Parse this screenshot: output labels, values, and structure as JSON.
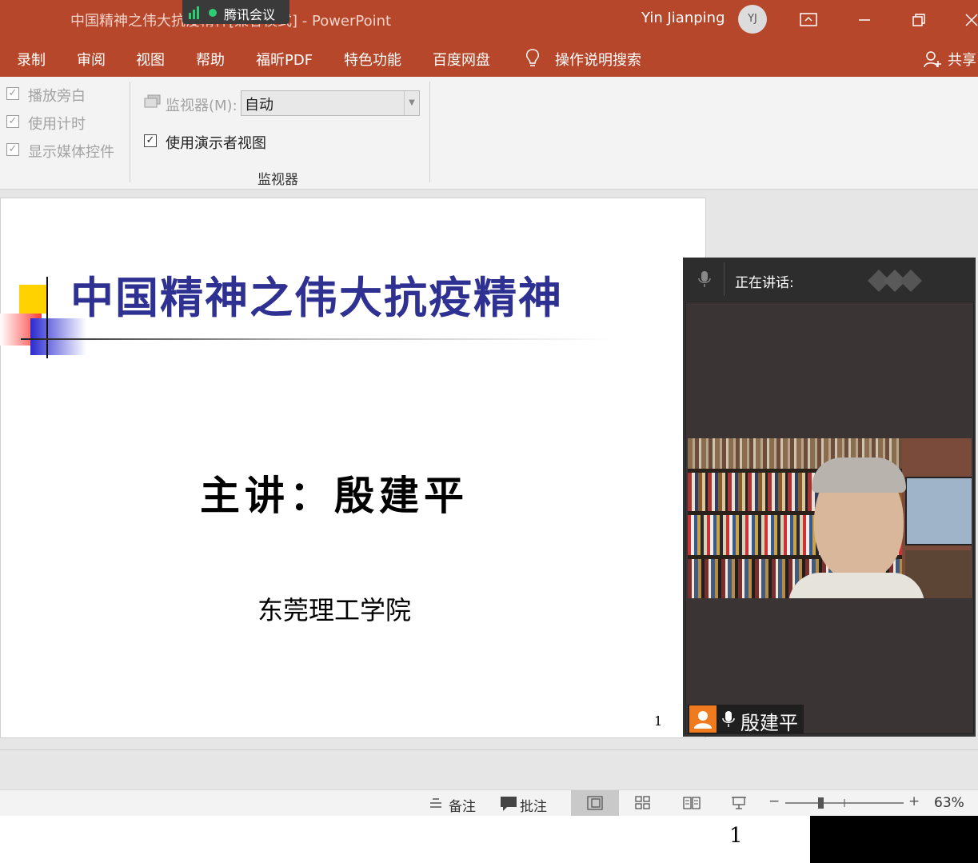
{
  "titlebar": {
    "doc_title": "中国精神之伟大抗疫精神[兼容模式]  -  PowerPoint",
    "meeting_app": "腾讯会议",
    "user_name": "Yin Jianping",
    "avatar_initials": "YJ"
  },
  "menu": {
    "items": [
      "录制",
      "审阅",
      "视图",
      "帮助",
      "福昕PDF",
      "特色功能",
      "百度网盘"
    ],
    "search_label": "操作说明搜索",
    "share_label": "共享"
  },
  "ribbon": {
    "checkboxes": [
      {
        "label": "播放旁白",
        "checked": true,
        "enabled": false
      },
      {
        "label": "使用计时",
        "checked": true,
        "enabled": false
      },
      {
        "label": "显示媒体控件",
        "checked": true,
        "enabled": false
      }
    ],
    "monitor_label": "监视器(M):",
    "monitor_value": "自动",
    "presenter_view_label": "使用演示者视图",
    "presenter_view_checked": true,
    "group_label": "监视器"
  },
  "slide": {
    "title": "中国精神之伟大抗疫精神",
    "speaker": "主讲：殷建平",
    "institution": "东莞理工学院",
    "page_number": "1"
  },
  "video": {
    "speaking_label": "正在讲话:",
    "participant_name": "殷建平"
  },
  "statusbar": {
    "notes_label": "备注",
    "comments_label": "批注",
    "zoom": "63%",
    "zoom_fraction": 0.3
  },
  "bottom": {
    "page_number": "1"
  },
  "colors": {
    "accent": "#b7472a",
    "slide_title": "#2e3191"
  }
}
